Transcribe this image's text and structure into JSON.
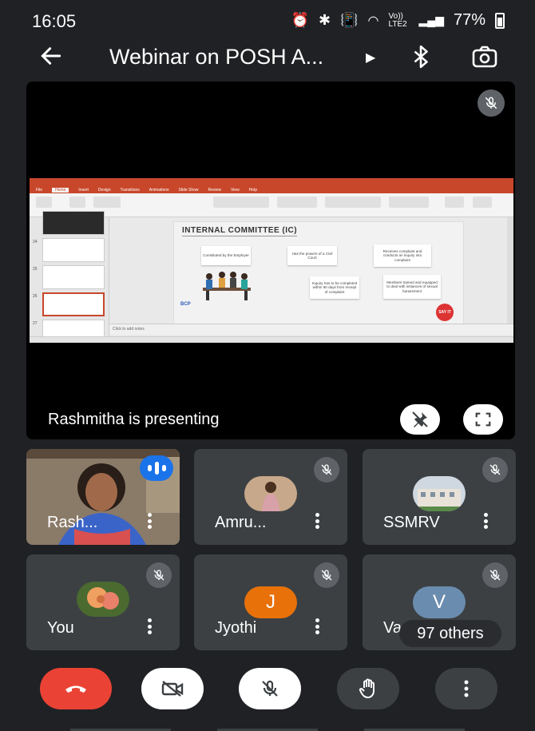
{
  "status_bar": {
    "time": "16:05",
    "signal_text": "Vo)) LTE2",
    "battery": "77%"
  },
  "header": {
    "title": "Webinar on POSH A...",
    "icons": [
      "back-arrow-icon",
      "caret-right-icon",
      "bluetooth-icon",
      "switch-camera-icon"
    ]
  },
  "stage": {
    "presenter_label": "Rashmitha is presenting",
    "slide": {
      "title": "INTERNAL COMMITTEE (IC)",
      "boxes": [
        "Constituted by the Employer",
        "Has the powers of a Civil Court",
        "Receives complaint and conducts an inquiry into complaint",
        "Inquiry has to be completed within 90 days from receipt of complaint",
        "Members trained and equipped to deal with instances of sexual harassment"
      ],
      "logo": "BCP",
      "badge": "SAY IT",
      "notes_placeholder": "Click to add notes",
      "slide_numbers": [
        "24",
        "25",
        "26",
        "27"
      ],
      "ribbon_tabs": [
        "File",
        "Home",
        "Insert",
        "Design",
        "Transitions",
        "Animations",
        "Slide Show",
        "Review",
        "View",
        "Help"
      ]
    }
  },
  "participants": [
    {
      "name": "Rash...",
      "type": "video",
      "speaking": true
    },
    {
      "name": "Amru...",
      "type": "photo",
      "muted": true
    },
    {
      "name": "SSMRV",
      "type": "photo",
      "muted": true
    },
    {
      "name": "You",
      "type": "photo",
      "muted": true
    },
    {
      "name": "Jyothi",
      "type": "letter",
      "letter": "J",
      "color": "#e8710a",
      "muted": true
    },
    {
      "name": "Va",
      "type": "letter",
      "letter": "V",
      "color": "#6a8caf",
      "muted": true
    }
  ],
  "others_label": "97 others",
  "controls": [
    "end-call-button",
    "camera-off-button",
    "mic-off-button",
    "raise-hand-button",
    "more-options-button"
  ],
  "colors": {
    "background": "#202124",
    "tile": "#3c4043",
    "end_call": "#ea4335",
    "speaking": "#1a73e8"
  }
}
